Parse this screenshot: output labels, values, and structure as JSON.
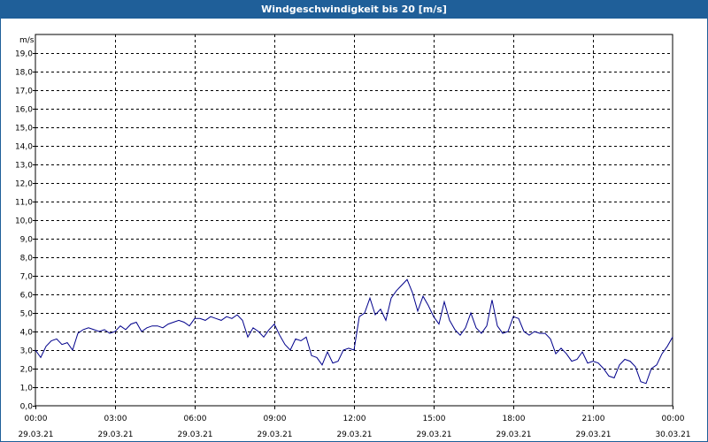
{
  "window": {
    "title": "Windgeschwindigkeit bis 20 [m/s]"
  },
  "chart_data": {
    "type": "line",
    "title": "Windgeschwindigkeit bis 20 [m/s]",
    "ylabel": "m/s",
    "xlabel": "",
    "ylim": [
      0,
      20
    ],
    "xlim": [
      0,
      24
    ],
    "grid": true,
    "line_color": "#00008b",
    "y_ticks": [
      "0,0",
      "1,0",
      "2,0",
      "3,0",
      "4,0",
      "5,0",
      "6,0",
      "7,0",
      "8,0",
      "9,0",
      "10,0",
      "11,0",
      "12,0",
      "13,0",
      "14,0",
      "15,0",
      "16,0",
      "17,0",
      "18,0",
      "19,0"
    ],
    "x_ticks": [
      {
        "time": "00:00",
        "date": "29.03.21"
      },
      {
        "time": "03:00",
        "date": "29.03.21"
      },
      {
        "time": "06:00",
        "date": "29.03.21"
      },
      {
        "time": "09:00",
        "date": "29.03.21"
      },
      {
        "time": "12:00",
        "date": "29.03.21"
      },
      {
        "time": "15:00",
        "date": "29.03.21"
      },
      {
        "time": "18:00",
        "date": "29.03.21"
      },
      {
        "time": "21:00",
        "date": "29.03.21"
      },
      {
        "time": "00:00",
        "date": "30.03.21"
      }
    ],
    "series": [
      {
        "x": [
          0.0,
          0.2,
          0.4,
          0.6,
          0.8,
          1.0,
          1.2,
          1.4,
          1.6,
          1.8,
          2.0,
          2.2,
          2.4,
          2.6,
          2.8,
          3.0,
          3.2,
          3.4,
          3.6,
          3.8,
          4.0,
          4.2,
          4.4,
          4.6,
          4.8,
          5.0,
          5.2,
          5.4,
          5.6,
          5.8,
          6.0,
          6.2,
          6.4,
          6.6,
          6.8,
          7.0,
          7.2,
          7.4,
          7.6,
          7.8,
          8.0,
          8.2,
          8.4,
          8.6,
          8.8,
          9.0,
          9.2,
          9.4,
          9.6,
          9.8,
          10.0,
          10.2,
          10.4,
          10.6,
          10.8,
          11.0,
          11.2,
          11.4,
          11.6,
          11.8,
          12.0,
          12.2,
          12.4,
          12.6,
          12.8,
          13.0,
          13.2,
          13.4,
          13.6,
          13.8,
          14.0,
          14.2,
          14.4,
          14.6,
          14.8,
          15.0,
          15.2,
          15.4,
          15.6,
          15.8,
          16.0,
          16.2,
          16.4,
          16.6,
          16.8,
          17.0,
          17.2,
          17.4,
          17.6,
          17.8,
          18.0,
          18.2,
          18.4,
          18.6,
          18.8,
          19.0,
          19.2,
          19.4,
          19.6,
          19.8,
          20.0,
          20.2,
          20.4,
          20.6,
          20.8,
          21.0,
          21.2,
          21.4,
          21.6,
          21.8,
          22.0,
          22.2,
          22.4,
          22.6,
          22.8,
          23.0,
          23.2,
          23.4,
          23.6,
          23.8,
          24.0
        ],
        "values": [
          3.0,
          2.6,
          3.2,
          3.5,
          3.6,
          3.3,
          3.4,
          3.0,
          3.9,
          4.1,
          4.2,
          4.1,
          4.0,
          4.1,
          3.9,
          4.0,
          4.3,
          4.1,
          4.4,
          4.5,
          4.0,
          4.2,
          4.3,
          4.3,
          4.2,
          4.4,
          4.5,
          4.6,
          4.5,
          4.3,
          4.7,
          4.7,
          4.6,
          4.8,
          4.7,
          4.6,
          4.8,
          4.7,
          4.9,
          4.6,
          3.7,
          4.2,
          4.0,
          3.7,
          4.1,
          4.4,
          3.8,
          3.3,
          3.0,
          3.6,
          3.5,
          3.7,
          2.7,
          2.6,
          2.2,
          2.9,
          2.3,
          2.4,
          3.0,
          3.1,
          3.0,
          4.8,
          5.0,
          5.8,
          4.9,
          5.2,
          4.6,
          5.8,
          6.2,
          6.5,
          6.8,
          6.1,
          5.1,
          5.9,
          5.4,
          4.8,
          4.4,
          5.6,
          4.6,
          4.1,
          3.8,
          4.2,
          5.0,
          4.2,
          3.9,
          4.3,
          5.7,
          4.3,
          3.9,
          4.0,
          4.8,
          4.7,
          4.0,
          3.8,
          4.0,
          3.9,
          3.9,
          3.6,
          2.8,
          3.1,
          2.8,
          2.4,
          2.5,
          2.9,
          2.3,
          2.4,
          2.3,
          2.0,
          1.6,
          1.5,
          2.2,
          2.5,
          2.4,
          2.1,
          1.3,
          1.2,
          2.0,
          2.2,
          2.8,
          3.2,
          3.7
        ]
      }
    ]
  }
}
